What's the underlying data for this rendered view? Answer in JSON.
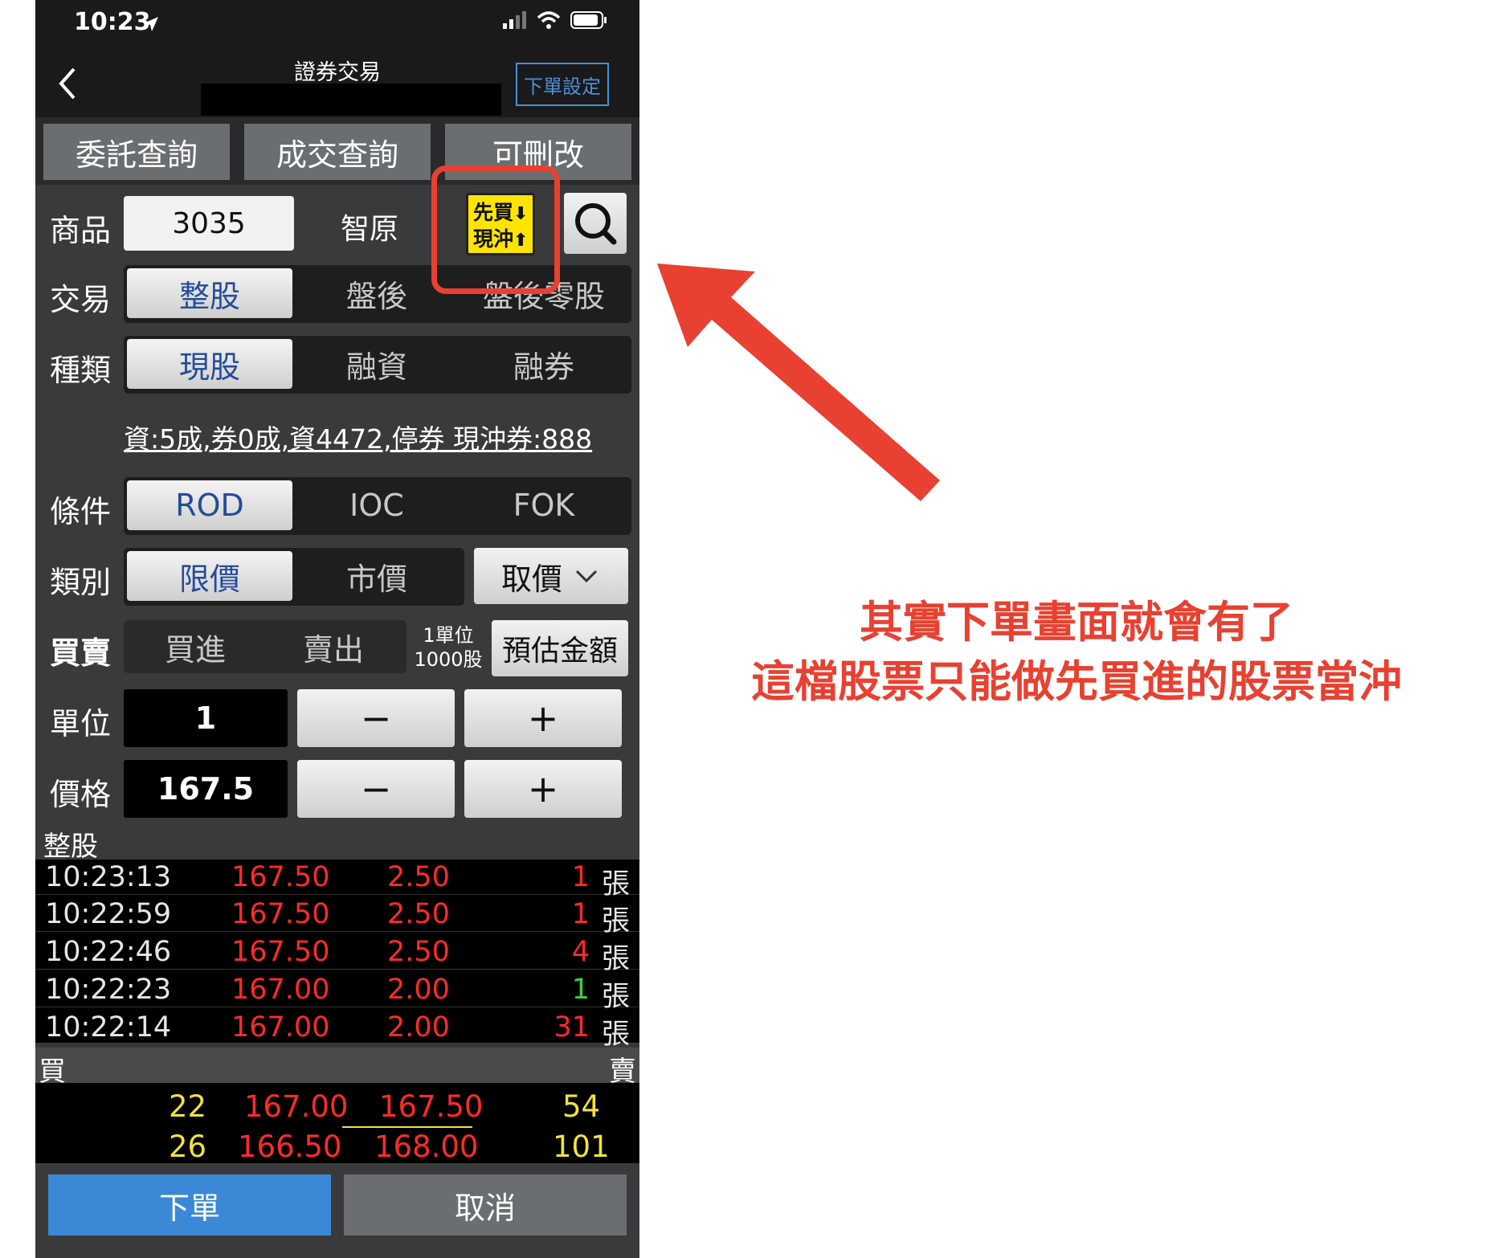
{
  "status_bar": {
    "time": "10:23"
  },
  "nav": {
    "title": "證券交易",
    "settings_label": "下單設定"
  },
  "query_tabs": [
    "委託查詢",
    "成交查詢",
    "可刪改"
  ],
  "product": {
    "label": "商品",
    "code": "3035",
    "name": "智原",
    "daytrade_badge_line1": "先買",
    "daytrade_badge_line2": "現沖"
  },
  "trade": {
    "label": "交易",
    "options": [
      "整股",
      "盤後",
      "盤後零股"
    ],
    "selected": "整股"
  },
  "category": {
    "label": "種類",
    "options": [
      "現股",
      "融資",
      "融券"
    ],
    "selected": "現股"
  },
  "margin_info": "資:5成,券0成,資4472,停券 現沖券:888",
  "condition": {
    "label": "條件",
    "options": [
      "ROD",
      "IOC",
      "FOK"
    ],
    "selected": "ROD"
  },
  "price_type": {
    "label": "類別",
    "options": [
      "限價",
      "市價"
    ],
    "selected": "限價",
    "price_select_label": "取價"
  },
  "side": {
    "label": "買賣",
    "options": [
      "買進",
      "賣出"
    ],
    "unit_note_1": "1單位",
    "unit_note_2": "1000股",
    "estimate_label": "預估金額"
  },
  "quantity": {
    "label": "單位",
    "value": "1",
    "minus": "−",
    "plus": "+"
  },
  "price": {
    "label": "價格",
    "value": "167.5",
    "minus": "−",
    "plus": "+"
  },
  "ticks": {
    "header": "整股",
    "rows": [
      {
        "time": "10:23:13",
        "price": "167.50",
        "change": "2.50",
        "volume": "1",
        "unit": "張",
        "vol_color": "#ff2b2b"
      },
      {
        "time": "10:22:59",
        "price": "167.50",
        "change": "2.50",
        "volume": "1",
        "unit": "張",
        "vol_color": "#ff2b2b"
      },
      {
        "time": "10:22:46",
        "price": "167.50",
        "change": "2.50",
        "volume": "4",
        "unit": "張",
        "vol_color": "#ff2b2b"
      },
      {
        "time": "10:22:23",
        "price": "167.00",
        "change": "2.00",
        "volume": "1",
        "unit": "張",
        "vol_color": "#3fd13f"
      },
      {
        "time": "10:22:14",
        "price": "167.00",
        "change": "2.00",
        "volume": "31",
        "unit": "張",
        "vol_color": "#ff2b2b"
      }
    ]
  },
  "order_book": {
    "buy_label": "買",
    "sell_label": "賣",
    "rows": [
      {
        "bid_qty": "22",
        "bid_price": "167.00",
        "ask_price": "167.50",
        "ask_qty": "54"
      },
      {
        "bid_qty": "26",
        "bid_price": "166.50",
        "ask_price": "168.00",
        "ask_qty": "101"
      }
    ]
  },
  "actions": {
    "order": "下單",
    "cancel": "取消"
  },
  "annotation": {
    "line1": "其實下單畫面就會有了",
    "line2": "這檔股票只能做先買進的股票當沖",
    "color": "#e84131"
  }
}
